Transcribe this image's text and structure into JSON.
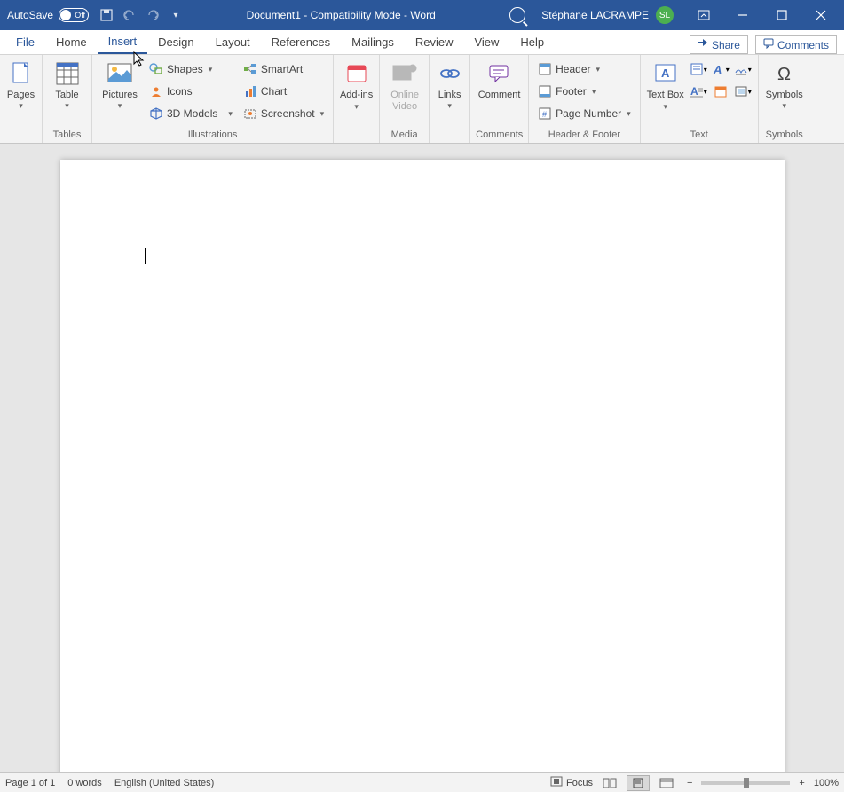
{
  "titlebar": {
    "autosave_label": "AutoSave",
    "autosave_state": "Off",
    "doc_title": "Document1  -  Compatibility Mode  -  Word",
    "user_name": "Stéphane LACRAMPE",
    "user_initials": "SL"
  },
  "tabs": {
    "file": "File",
    "home": "Home",
    "insert": "Insert",
    "design": "Design",
    "layout": "Layout",
    "references": "References",
    "mailings": "Mailings",
    "review": "Review",
    "view": "View",
    "help": "Help",
    "share": "Share",
    "comments": "Comments"
  },
  "ribbon": {
    "pages": {
      "label": "Pages",
      "btn": "Pages"
    },
    "tables": {
      "label": "Tables",
      "btn": "Table"
    },
    "illustrations": {
      "label": "Illustrations",
      "pictures": "Pictures",
      "shapes": "Shapes",
      "icons": "Icons",
      "models": "3D Models",
      "smartart": "SmartArt",
      "chart": "Chart",
      "screenshot": "Screenshot"
    },
    "addins": {
      "label": "",
      "btn": "Add-ins"
    },
    "media": {
      "label": "Media",
      "btn": "Online Video"
    },
    "links": {
      "label": "",
      "btn": "Links"
    },
    "comments": {
      "label": "Comments",
      "btn": "Comment"
    },
    "headerfooter": {
      "label": "Header & Footer",
      "header": "Header",
      "footer": "Footer",
      "pagenum": "Page Number"
    },
    "text": {
      "label": "Text",
      "textbox": "Text Box"
    },
    "symbols": {
      "label": "Symbols",
      "btn": "Symbols"
    }
  },
  "statusbar": {
    "page": "Page 1 of 1",
    "words": "0 words",
    "lang": "English (United States)",
    "focus": "Focus",
    "zoom": "100%"
  }
}
